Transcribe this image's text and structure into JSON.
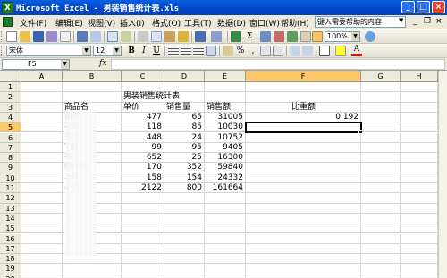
{
  "window": {
    "title": "Microsoft Excel - 男装销售统计表.xls",
    "app_icon": "X"
  },
  "caption_buttons": {
    "minimize": "_",
    "maximize": "□",
    "close": "×"
  },
  "menu": [
    "文件(F)",
    "编辑(E)",
    "视图(V)",
    "插入(I)",
    "格式(O)",
    "工具(T)",
    "数据(D)",
    "窗口(W)",
    "帮助(H)"
  ],
  "help": {
    "placeholder": "键入需要帮助的内容"
  },
  "mdi_buttons": {
    "minimize": "_",
    "restore": "❐",
    "close": "×"
  },
  "toolbar": {
    "zoom": "100%"
  },
  "format_toolbar": {
    "font": "宋体",
    "size": "12",
    "bold": "B",
    "italic": "I",
    "underline": "U"
  },
  "formula_bar": {
    "name_box": "F5",
    "fx": "fx",
    "formula": ""
  },
  "columns": [
    "A",
    "B",
    "C",
    "D",
    "E",
    "F",
    "G",
    "H"
  ],
  "selected_column": "F",
  "rows": [
    "1",
    "2",
    "3",
    "4",
    "5",
    "6",
    "7",
    "8",
    "9",
    "10",
    "11",
    "12",
    "13",
    "14",
    "15",
    "16",
    "17",
    "18",
    "19",
    "20"
  ],
  "selected_row": "5",
  "sheet": {
    "title": "男装销售统计表",
    "headers": {
      "product": "商品名",
      "price": "单价",
      "qty": "销售量",
      "amount": "销售额",
      "ratio": "比重额"
    },
    "items": [
      {
        "name": "西装",
        "price": "477",
        "qty": "65",
        "amount": "31005",
        "ratio": "0.192"
      },
      {
        "name": "衬衫",
        "price": "118",
        "qty": "85",
        "amount": "10030",
        "ratio": ""
      },
      {
        "name": "夹克",
        "price": "448",
        "qty": "24",
        "amount": "10752",
        "ratio": ""
      },
      {
        "name": "T恤",
        "price": "99",
        "qty": "95",
        "amount": "9405",
        "ratio": ""
      },
      {
        "name": "裤子",
        "price": "652",
        "qty": "25",
        "amount": "16300",
        "ratio": ""
      },
      {
        "name": "新风衣",
        "price": "170",
        "qty": "352",
        "amount": "59840",
        "ratio": ""
      },
      {
        "name": "马甲",
        "price": "158",
        "qty": "154",
        "amount": "24332",
        "ratio": ""
      }
    ],
    "total": {
      "label": "小计",
      "price": "2122",
      "qty": "800",
      "amount": "161664"
    }
  }
}
